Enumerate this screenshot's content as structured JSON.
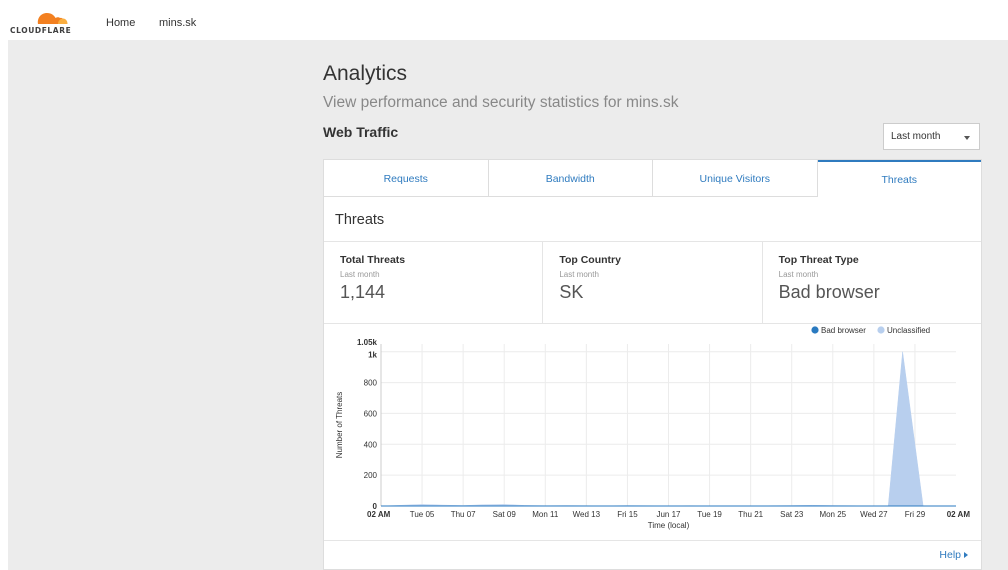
{
  "brand": {
    "logo_text": "CLOUDFLARE",
    "accent": "#f38020",
    "link_color": "#2f7bbf"
  },
  "nav": {
    "home": "Home",
    "site": "mins.sk"
  },
  "page": {
    "title": "Analytics",
    "subtitle": "View performance and security statistics for mins.sk",
    "section": "Web Traffic",
    "range_select": "Last month"
  },
  "tabs": [
    {
      "label": "Requests"
    },
    {
      "label": "Bandwidth"
    },
    {
      "label": "Unique Visitors"
    },
    {
      "label": "Threats"
    }
  ],
  "threats": {
    "heading": "Threats",
    "stats": [
      {
        "label": "Total Threats",
        "period": "Last month",
        "value": "1,144"
      },
      {
        "label": "Top Country",
        "period": "Last month",
        "value": "SK"
      },
      {
        "label": "Top Threat Type",
        "period": "Last month",
        "value": "Bad browser"
      }
    ],
    "help": "Help"
  },
  "chart_data": {
    "type": "area",
    "xlabel": "Time (local)",
    "ylabel": "Number of Threats",
    "ylim": [
      0,
      1050
    ],
    "yticks": [
      "0",
      "200",
      "400",
      "600",
      "800",
      "1k",
      "1.05k"
    ],
    "ytick_values": [
      0,
      200,
      400,
      600,
      800,
      1000,
      1050
    ],
    "x_tick_labels": [
      "02 AM",
      "Tue 05",
      "Thu 07",
      "Sat 09",
      "Mon 11",
      "Wed 13",
      "Fri 15",
      "Jun 17",
      "Tue 19",
      "Thu 21",
      "Sat 23",
      "Mon 25",
      "Wed 27",
      "Fri 29",
      "02 AM"
    ],
    "legend_position": "top-right",
    "grid": true,
    "series": [
      {
        "name": "Bad browser",
        "color": "#2a7ac0",
        "x": [
          0,
          28
        ],
        "values": [
          0,
          0
        ]
      },
      {
        "name": "Unclassified",
        "color": "#b8cfee",
        "x": [
          0,
          1,
          2,
          3,
          4,
          5,
          6,
          7,
          8,
          9,
          10,
          11,
          12,
          13,
          14,
          15,
          16,
          17,
          18,
          19,
          20,
          21,
          22,
          23,
          24,
          24.7,
          25.4,
          26.4,
          28
        ],
        "values": [
          0,
          5,
          10,
          6,
          3,
          8,
          10,
          4,
          2,
          3,
          2,
          1,
          3,
          2,
          1,
          2,
          1,
          1,
          0,
          2,
          3,
          5,
          3,
          2,
          0,
          0,
          1000,
          0,
          0
        ]
      }
    ]
  }
}
